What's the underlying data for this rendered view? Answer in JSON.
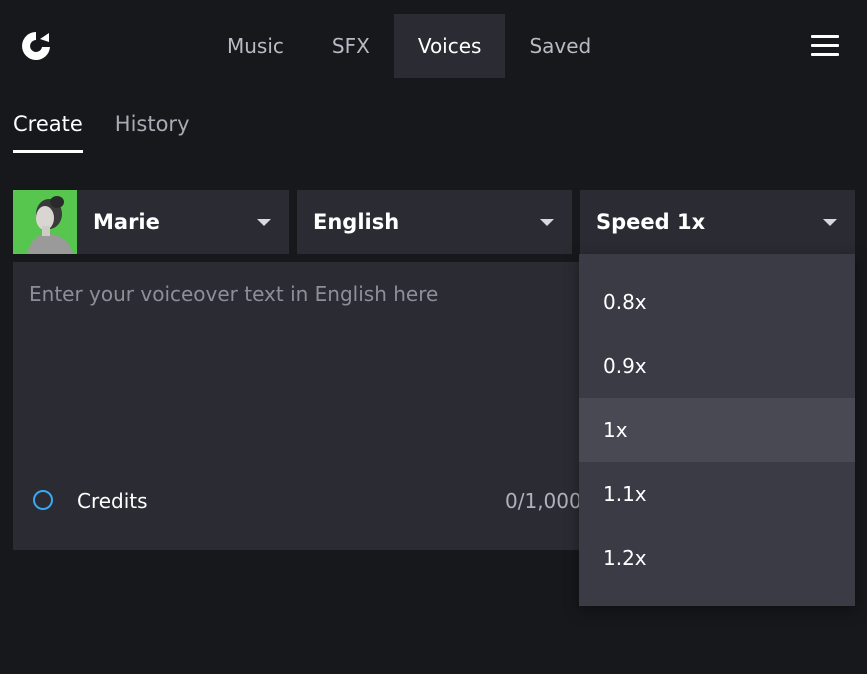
{
  "nav": {
    "items": [
      {
        "label": "Music",
        "active": false
      },
      {
        "label": "SFX",
        "active": false
      },
      {
        "label": "Voices",
        "active": true
      },
      {
        "label": "Saved",
        "active": false
      }
    ]
  },
  "subtabs": [
    {
      "label": "Create",
      "active": true
    },
    {
      "label": "History",
      "active": false
    }
  ],
  "voice_select": {
    "value": "Marie"
  },
  "language_select": {
    "value": "English"
  },
  "speed_select": {
    "value": "Speed 1x",
    "options": [
      "0.8x",
      "0.9x",
      "1x",
      "1.1x",
      "1.2x"
    ],
    "selected": "1x"
  },
  "editor": {
    "placeholder": "Enter your voiceover text in English here",
    "credits_label": "Credits",
    "char_count": "0/1,000"
  },
  "colors": {
    "background": "#17181c",
    "panel": "#2b2c33",
    "dropdown": "#3a3b44",
    "accent": "#3aa7f4",
    "avatar_bg": "#56c64f"
  },
  "icons": [
    "logo-icon",
    "hamburger-menu-icon",
    "caret-down-icon",
    "credits-circle-icon"
  ]
}
